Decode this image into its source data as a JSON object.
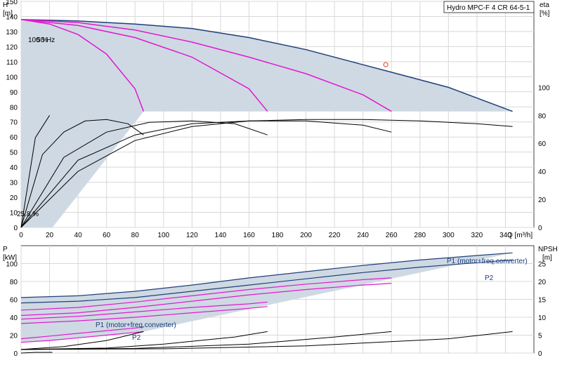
{
  "chart_data": [
    {
      "type": "line",
      "title_box": "Hydro MPC-F 4 CR 64-5-1",
      "left_axis_label_1": "H",
      "left_axis_label_2": "[m]",
      "right_axis_label_1": "eta",
      "right_axis_label_2": "[%]",
      "x_axis_label": "Q [m³/h]",
      "xlim": [
        0,
        360
      ],
      "ylim": [
        0,
        150
      ],
      "right_ylim": [
        0,
        100
      ],
      "x_ticks": [
        "0",
        "20",
        "40",
        "60",
        "80",
        "100",
        "120",
        "140",
        "160",
        "180",
        "200",
        "220",
        "240",
        "260",
        "280",
        "300",
        "320",
        "340"
      ],
      "y_ticks": [
        "0",
        "10",
        "20",
        "30",
        "40",
        "50",
        "60",
        "70",
        "80",
        "90",
        "100",
        "110",
        "120",
        "130",
        "140",
        "150"
      ],
      "right_ticks": [
        "0",
        "20",
        "40",
        "60",
        "80",
        "100"
      ],
      "annotations": [
        "100 %",
        "50 Hz",
        "25.8 %"
      ],
      "colors": {
        "full_curve": "#1f3f7a",
        "partial_curves": "#e01ad0",
        "area": "#cfd9e3",
        "eta": "#000000",
        "duty_point": "#e06050"
      },
      "series": [
        {
          "x": [
            0,
            40,
            80,
            120,
            160,
            200,
            240,
            260,
            300,
            345
          ],
          "y": [
            138,
            137,
            135,
            132,
            126,
            118,
            108,
            103,
            93,
            77
          ]
        },
        {
          "x": [
            0,
            40,
            80,
            120,
            160,
            200,
            240,
            260
          ],
          "y": [
            138,
            136,
            131,
            123,
            113,
            102,
            88,
            77
          ]
        },
        {
          "x": [
            0,
            40,
            80,
            120,
            160,
            173
          ],
          "y": [
            138,
            134,
            126,
            113,
            92,
            77
          ]
        },
        {
          "x": [
            0,
            20,
            40,
            60,
            80,
            86
          ],
          "y": [
            138,
            135,
            128,
            115,
            92,
            77
          ]
        }
      ],
      "duty_point": {
        "x": 256,
        "y": 108
      },
      "eta_series": [
        {
          "x": [
            0,
            40,
            80,
            120,
            160,
            200,
            240,
            280,
            320,
            345
          ],
          "y": [
            0,
            40,
            62,
            72,
            76,
            77,
            77,
            76,
            74,
            72
          ]
        },
        {
          "x": [
            0,
            40,
            80,
            120,
            160,
            200,
            240,
            260
          ],
          "y": [
            0,
            48,
            66,
            74,
            76,
            76,
            73,
            68
          ]
        },
        {
          "x": [
            0,
            30,
            60,
            90,
            120,
            150,
            173
          ],
          "y": [
            0,
            50,
            68,
            75,
            76,
            74,
            66
          ]
        },
        {
          "x": [
            0,
            15,
            30,
            45,
            60,
            75,
            86
          ],
          "y": [
            0,
            52,
            68,
            76,
            77,
            74,
            66
          ]
        },
        {
          "x": [
            0,
            10,
            20
          ],
          "y": [
            0,
            64,
            80
          ]
        }
      ]
    },
    {
      "type": "line",
      "left_axis_label_1": "P",
      "left_axis_label_2": "[kW]",
      "right_axis_label_1": "NPSH",
      "right_axis_label_2": "[m]",
      "xlim": [
        0,
        360
      ],
      "ylim": [
        0,
        120
      ],
      "right_ylim": [
        0,
        30
      ],
      "y_ticks": [
        "0",
        "20",
        "40",
        "60",
        "80",
        "100"
      ],
      "right_ticks": [
        "0",
        "5",
        "10",
        "15",
        "20",
        "25"
      ],
      "labels": {
        "p1_top": "P1 (motor+freq.converter)",
        "p2_top": "P2",
        "p1_bottom": "P1 (motor+freq.converter)",
        "p2_bottom": "P2"
      },
      "series": [
        {
          "x": [
            0,
            40,
            80,
            120,
            160,
            200,
            240,
            280,
            320,
            345
          ],
          "y": [
            62,
            64,
            69,
            76,
            84,
            91,
            98,
            104,
            109,
            112
          ]
        },
        {
          "x": [
            0,
            40,
            80,
            120,
            160,
            200,
            240,
            280,
            320,
            345
          ],
          "y": [
            56,
            58,
            62,
            69,
            76,
            83,
            90,
            96,
            101,
            104
          ]
        },
        {
          "x": [
            0,
            40,
            80,
            120,
            160,
            200,
            240,
            260
          ],
          "y": [
            48,
            51,
            57,
            64,
            71,
            77,
            82,
            84
          ]
        },
        {
          "x": [
            0,
            40,
            80,
            120,
            160,
            200,
            240,
            260
          ],
          "y": [
            42,
            45,
            51,
            58,
            65,
            71,
            76,
            78
          ]
        },
        {
          "x": [
            0,
            40,
            80,
            120,
            160,
            173
          ],
          "y": [
            38,
            41,
            46,
            51,
            55,
            57
          ]
        },
        {
          "x": [
            0,
            40,
            80,
            120,
            160,
            173
          ],
          "y": [
            33,
            36,
            40,
            45,
            50,
            52
          ]
        },
        {
          "x": [
            0,
            20,
            40,
            60,
            80,
            86
          ],
          "y": [
            16,
            19,
            22,
            25,
            28,
            29
          ]
        },
        {
          "x": [
            0,
            20,
            40,
            60,
            80,
            86
          ],
          "y": [
            12,
            14,
            17,
            20,
            23,
            24
          ]
        }
      ],
      "npsh_series": [
        {
          "x": [
            0,
            100,
            200,
            300,
            345
          ],
          "y": [
            1,
            1.2,
            2,
            4,
            6
          ]
        },
        {
          "x": [
            0,
            80,
            160,
            220,
            260
          ],
          "y": [
            1,
            1.3,
            2.5,
            4.5,
            6
          ]
        },
        {
          "x": [
            0,
            60,
            100,
            150,
            173
          ],
          "y": [
            1,
            1.4,
            2.5,
            4.5,
            6
          ]
        },
        {
          "x": [
            0,
            30,
            60,
            86
          ],
          "y": [
            1,
            1.8,
            3.5,
            6
          ]
        },
        {
          "x": [
            0,
            10,
            22
          ],
          "y": [
            0,
            0.2,
            0.2
          ]
        }
      ]
    }
  ]
}
